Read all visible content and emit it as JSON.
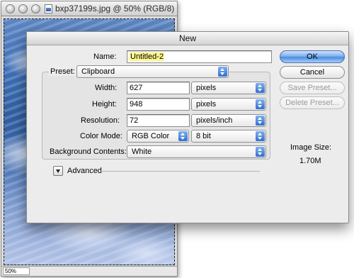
{
  "document": {
    "title": "bxp37199s.jpg @ 50% (RGB/8)",
    "zoom": "50%"
  },
  "dialog": {
    "title": "New",
    "name_label": "Name:",
    "name_value": "Untitled-2",
    "preset_label": "Preset:",
    "preset_value": "Clipboard",
    "width_label": "Width:",
    "width_value": "627",
    "width_unit": "pixels",
    "height_label": "Height:",
    "height_value": "948",
    "height_unit": "pixels",
    "resolution_label": "Resolution:",
    "resolution_value": "72",
    "resolution_unit": "pixels/inch",
    "color_mode_label": "Color Mode:",
    "color_mode_value": "RGB Color",
    "bit_depth_value": "8 bit",
    "background_label": "Background Contents:",
    "background_value": "White",
    "advanced_label": "Advanced",
    "image_size_label": "Image Size:",
    "image_size_value": "1.70M",
    "buttons": {
      "ok": "OK",
      "cancel": "Cancel",
      "save_preset": "Save Preset...",
      "delete_preset": "Delete Preset..."
    }
  },
  "colors": {
    "name_highlight": "#fff68e",
    "default_button": "#4b8de0",
    "popup_arrow": "#2f6fd0"
  }
}
